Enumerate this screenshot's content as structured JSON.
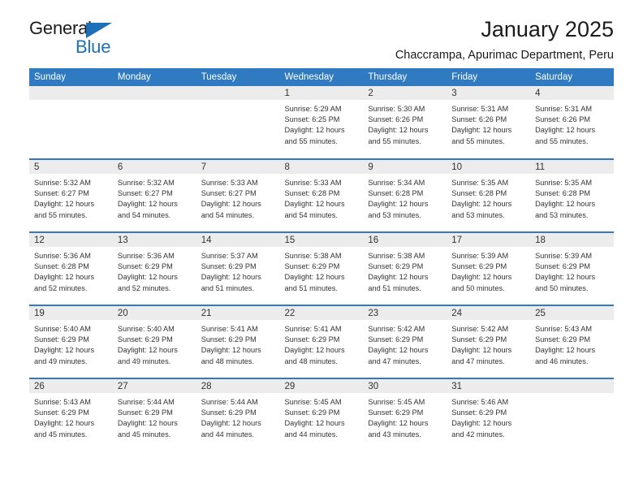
{
  "brand": {
    "name_part1": "General",
    "name_part2": "Blue",
    "accent_color": "#1d70b7",
    "logo_icon": "triangle-flag-icon"
  },
  "header": {
    "title": "January 2025",
    "subtitle": "Chaccrampa, Apurimac Department, Peru"
  },
  "calendar": {
    "header_bg_color": "#2f7ac0",
    "daynum_bg_color": "#ececec",
    "weekday_headers": [
      "Sunday",
      "Monday",
      "Tuesday",
      "Wednesday",
      "Thursday",
      "Friday",
      "Saturday"
    ],
    "weeks": [
      [
        {
          "day": "",
          "sunrise": "",
          "sunset": "",
          "daylight_line1": "",
          "daylight_line2": ""
        },
        {
          "day": "",
          "sunrise": "",
          "sunset": "",
          "daylight_line1": "",
          "daylight_line2": ""
        },
        {
          "day": "",
          "sunrise": "",
          "sunset": "",
          "daylight_line1": "",
          "daylight_line2": ""
        },
        {
          "day": "1",
          "sunrise": "Sunrise: 5:29 AM",
          "sunset": "Sunset: 6:25 PM",
          "daylight_line1": "Daylight: 12 hours",
          "daylight_line2": "and 55 minutes."
        },
        {
          "day": "2",
          "sunrise": "Sunrise: 5:30 AM",
          "sunset": "Sunset: 6:26 PM",
          "daylight_line1": "Daylight: 12 hours",
          "daylight_line2": "and 55 minutes."
        },
        {
          "day": "3",
          "sunrise": "Sunrise: 5:31 AM",
          "sunset": "Sunset: 6:26 PM",
          "daylight_line1": "Daylight: 12 hours",
          "daylight_line2": "and 55 minutes."
        },
        {
          "day": "4",
          "sunrise": "Sunrise: 5:31 AM",
          "sunset": "Sunset: 6:26 PM",
          "daylight_line1": "Daylight: 12 hours",
          "daylight_line2": "and 55 minutes."
        }
      ],
      [
        {
          "day": "5",
          "sunrise": "Sunrise: 5:32 AM",
          "sunset": "Sunset: 6:27 PM",
          "daylight_line1": "Daylight: 12 hours",
          "daylight_line2": "and 55 minutes."
        },
        {
          "day": "6",
          "sunrise": "Sunrise: 5:32 AM",
          "sunset": "Sunset: 6:27 PM",
          "daylight_line1": "Daylight: 12 hours",
          "daylight_line2": "and 54 minutes."
        },
        {
          "day": "7",
          "sunrise": "Sunrise: 5:33 AM",
          "sunset": "Sunset: 6:27 PM",
          "daylight_line1": "Daylight: 12 hours",
          "daylight_line2": "and 54 minutes."
        },
        {
          "day": "8",
          "sunrise": "Sunrise: 5:33 AM",
          "sunset": "Sunset: 6:28 PM",
          "daylight_line1": "Daylight: 12 hours",
          "daylight_line2": "and 54 minutes."
        },
        {
          "day": "9",
          "sunrise": "Sunrise: 5:34 AM",
          "sunset": "Sunset: 6:28 PM",
          "daylight_line1": "Daylight: 12 hours",
          "daylight_line2": "and 53 minutes."
        },
        {
          "day": "10",
          "sunrise": "Sunrise: 5:35 AM",
          "sunset": "Sunset: 6:28 PM",
          "daylight_line1": "Daylight: 12 hours",
          "daylight_line2": "and 53 minutes."
        },
        {
          "day": "11",
          "sunrise": "Sunrise: 5:35 AM",
          "sunset": "Sunset: 6:28 PM",
          "daylight_line1": "Daylight: 12 hours",
          "daylight_line2": "and 53 minutes."
        }
      ],
      [
        {
          "day": "12",
          "sunrise": "Sunrise: 5:36 AM",
          "sunset": "Sunset: 6:28 PM",
          "daylight_line1": "Daylight: 12 hours",
          "daylight_line2": "and 52 minutes."
        },
        {
          "day": "13",
          "sunrise": "Sunrise: 5:36 AM",
          "sunset": "Sunset: 6:29 PM",
          "daylight_line1": "Daylight: 12 hours",
          "daylight_line2": "and 52 minutes."
        },
        {
          "day": "14",
          "sunrise": "Sunrise: 5:37 AM",
          "sunset": "Sunset: 6:29 PM",
          "daylight_line1": "Daylight: 12 hours",
          "daylight_line2": "and 51 minutes."
        },
        {
          "day": "15",
          "sunrise": "Sunrise: 5:38 AM",
          "sunset": "Sunset: 6:29 PM",
          "daylight_line1": "Daylight: 12 hours",
          "daylight_line2": "and 51 minutes."
        },
        {
          "day": "16",
          "sunrise": "Sunrise: 5:38 AM",
          "sunset": "Sunset: 6:29 PM",
          "daylight_line1": "Daylight: 12 hours",
          "daylight_line2": "and 51 minutes."
        },
        {
          "day": "17",
          "sunrise": "Sunrise: 5:39 AM",
          "sunset": "Sunset: 6:29 PM",
          "daylight_line1": "Daylight: 12 hours",
          "daylight_line2": "and 50 minutes."
        },
        {
          "day": "18",
          "sunrise": "Sunrise: 5:39 AM",
          "sunset": "Sunset: 6:29 PM",
          "daylight_line1": "Daylight: 12 hours",
          "daylight_line2": "and 50 minutes."
        }
      ],
      [
        {
          "day": "19",
          "sunrise": "Sunrise: 5:40 AM",
          "sunset": "Sunset: 6:29 PM",
          "daylight_line1": "Daylight: 12 hours",
          "daylight_line2": "and 49 minutes."
        },
        {
          "day": "20",
          "sunrise": "Sunrise: 5:40 AM",
          "sunset": "Sunset: 6:29 PM",
          "daylight_line1": "Daylight: 12 hours",
          "daylight_line2": "and 49 minutes."
        },
        {
          "day": "21",
          "sunrise": "Sunrise: 5:41 AM",
          "sunset": "Sunset: 6:29 PM",
          "daylight_line1": "Daylight: 12 hours",
          "daylight_line2": "and 48 minutes."
        },
        {
          "day": "22",
          "sunrise": "Sunrise: 5:41 AM",
          "sunset": "Sunset: 6:29 PM",
          "daylight_line1": "Daylight: 12 hours",
          "daylight_line2": "and 48 minutes."
        },
        {
          "day": "23",
          "sunrise": "Sunrise: 5:42 AM",
          "sunset": "Sunset: 6:29 PM",
          "daylight_line1": "Daylight: 12 hours",
          "daylight_line2": "and 47 minutes."
        },
        {
          "day": "24",
          "sunrise": "Sunrise: 5:42 AM",
          "sunset": "Sunset: 6:29 PM",
          "daylight_line1": "Daylight: 12 hours",
          "daylight_line2": "and 47 minutes."
        },
        {
          "day": "25",
          "sunrise": "Sunrise: 5:43 AM",
          "sunset": "Sunset: 6:29 PM",
          "daylight_line1": "Daylight: 12 hours",
          "daylight_line2": "and 46 minutes."
        }
      ],
      [
        {
          "day": "26",
          "sunrise": "Sunrise: 5:43 AM",
          "sunset": "Sunset: 6:29 PM",
          "daylight_line1": "Daylight: 12 hours",
          "daylight_line2": "and 45 minutes."
        },
        {
          "day": "27",
          "sunrise": "Sunrise: 5:44 AM",
          "sunset": "Sunset: 6:29 PM",
          "daylight_line1": "Daylight: 12 hours",
          "daylight_line2": "and 45 minutes."
        },
        {
          "day": "28",
          "sunrise": "Sunrise: 5:44 AM",
          "sunset": "Sunset: 6:29 PM",
          "daylight_line1": "Daylight: 12 hours",
          "daylight_line2": "and 44 minutes."
        },
        {
          "day": "29",
          "sunrise": "Sunrise: 5:45 AM",
          "sunset": "Sunset: 6:29 PM",
          "daylight_line1": "Daylight: 12 hours",
          "daylight_line2": "and 44 minutes."
        },
        {
          "day": "30",
          "sunrise": "Sunrise: 5:45 AM",
          "sunset": "Sunset: 6:29 PM",
          "daylight_line1": "Daylight: 12 hours",
          "daylight_line2": "and 43 minutes."
        },
        {
          "day": "31",
          "sunrise": "Sunrise: 5:46 AM",
          "sunset": "Sunset: 6:29 PM",
          "daylight_line1": "Daylight: 12 hours",
          "daylight_line2": "and 42 minutes."
        },
        {
          "day": "",
          "sunrise": "",
          "sunset": "",
          "daylight_line1": "",
          "daylight_line2": ""
        }
      ]
    ]
  }
}
